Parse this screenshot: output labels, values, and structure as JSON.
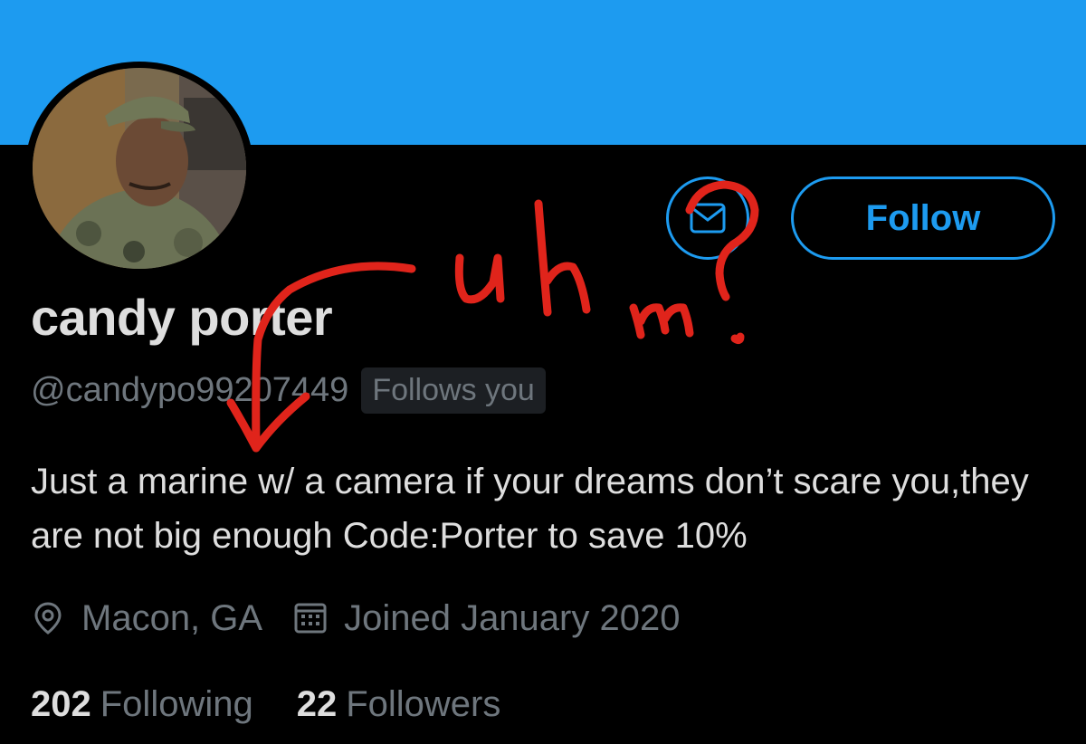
{
  "colors": {
    "banner": "#1d9bf0",
    "accent": "#1d9bf0",
    "background": "#000000",
    "primary_text": "#dedede",
    "secondary_text": "#6e767d",
    "annotation_red": "#e0241b"
  },
  "profile": {
    "display_name": "candy porter",
    "handle": "@candypo99207449",
    "follows_you_badge": "Follows you",
    "bio": "Just a marine w/ a camera if your dreams don’t scare you,they are not big enough Code:Porter to save 10%",
    "location": "Macon, GA",
    "joined": "Joined January 2020",
    "location_icon": "location-pin-icon",
    "joined_icon": "calendar-icon"
  },
  "actions": {
    "message_icon": "envelope-icon",
    "follow_label": "Follow"
  },
  "stats": {
    "following_count": "202",
    "following_label": "Following",
    "followers_count": "22",
    "followers_label": "Followers"
  },
  "annotation": {
    "handwritten_text": "Uhm?"
  }
}
